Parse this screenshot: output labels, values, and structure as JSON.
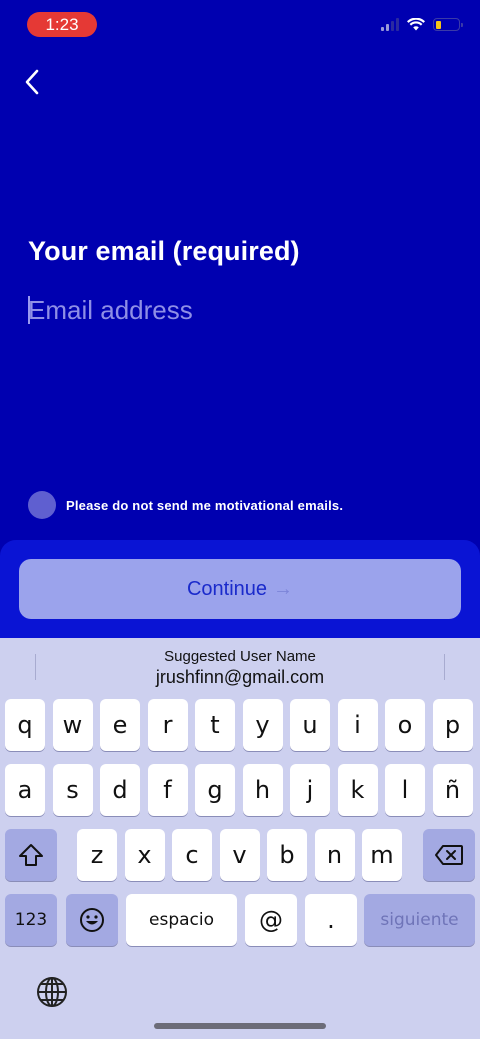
{
  "status_bar": {
    "time": "1:23"
  },
  "page": {
    "title": "Your email (required)",
    "email_placeholder": "Email address",
    "optout_label": "Please do not send me motivational emails.",
    "continue_label": "Continue",
    "continue_arrow": "→"
  },
  "keyboard": {
    "suggestion_title": "Suggested User Name",
    "suggestion_value": "jrushfinn@gmail.com",
    "row1": [
      "q",
      "w",
      "e",
      "r",
      "t",
      "y",
      "u",
      "i",
      "o",
      "p"
    ],
    "row2": [
      "a",
      "s",
      "d",
      "f",
      "g",
      "h",
      "j",
      "k",
      "l",
      "ñ"
    ],
    "row3": [
      "z",
      "x",
      "c",
      "v",
      "b",
      "n",
      "m"
    ],
    "numbers_label": "123",
    "space_label": "espacio",
    "at_label": "@",
    "dot_label": ".",
    "next_label": "siguiente"
  },
  "colors": {
    "background": "#0000b0",
    "time_pill": "#e53935",
    "continue_button": "#9ba3ec",
    "keyboard_bg": "#cdd0ef"
  }
}
